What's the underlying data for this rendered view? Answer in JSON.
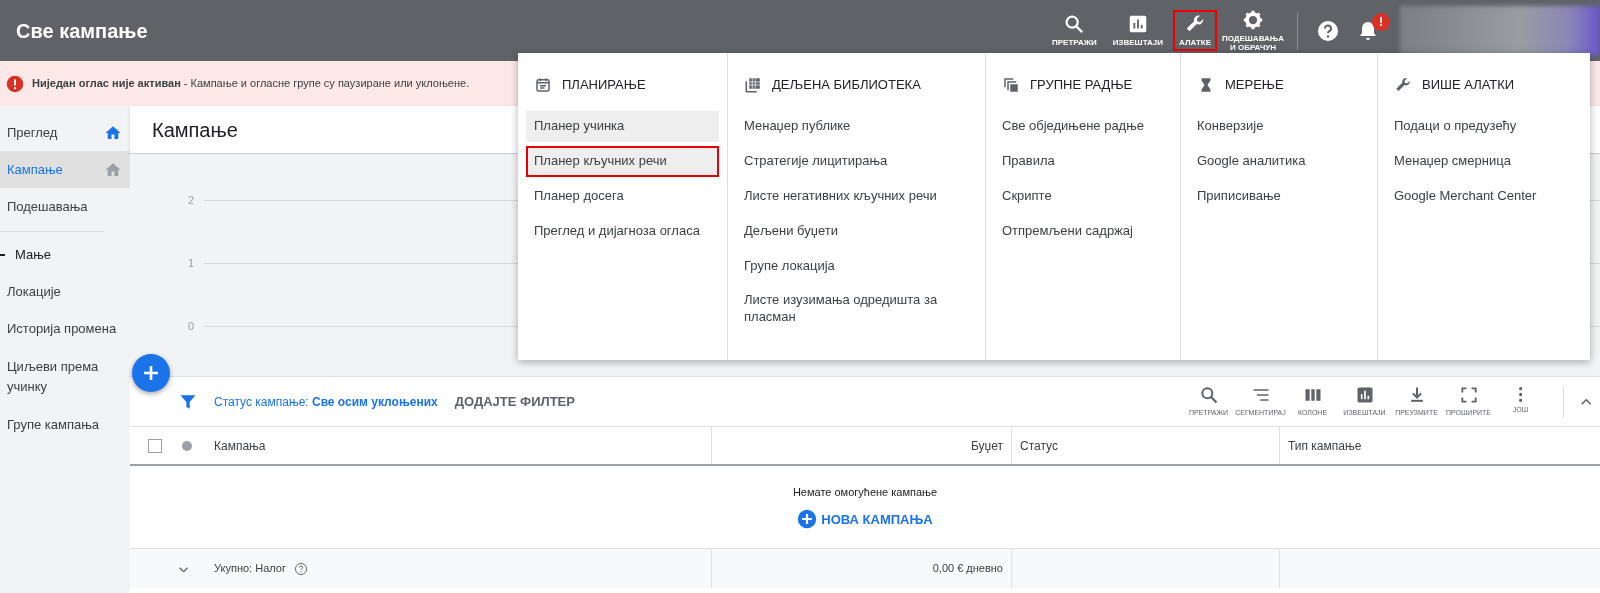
{
  "header": {
    "title": "Све кампање",
    "actions": [
      {
        "kind": "search",
        "label": "ПРЕТРАЖИ",
        "highlighted": false
      },
      {
        "kind": "reports",
        "label": "ИЗВЕШТАЈИ",
        "highlighted": false
      },
      {
        "kind": "tools",
        "label": "АЛАТКЕ",
        "highlighted": true
      },
      {
        "kind": "settings",
        "label": "ПОДЕШАВАЊА И ОБРАЧУН",
        "highlighted": false
      }
    ],
    "notification_badge": "!"
  },
  "alert": {
    "title": "Ниједан оглас није активан",
    "message": " - Кампање и огласне групе су паузиране или уклоњене."
  },
  "sidebar": {
    "items": [
      {
        "label": "Преглед",
        "kind": "home",
        "selected": false
      },
      {
        "label": "Кампање",
        "kind": "home",
        "selected": true
      },
      {
        "label": "Подешавања",
        "kind": "plain",
        "selected": false
      },
      {
        "label": "Мање",
        "kind": "toggle",
        "selected": false
      },
      {
        "label": "Локације",
        "kind": "plain",
        "selected": false
      },
      {
        "label": "Историја промена",
        "kind": "plain",
        "selected": false
      },
      {
        "label": "Циљеви према учинку",
        "kind": "plain",
        "selected": false
      },
      {
        "label": "Групе кампања",
        "kind": "plain",
        "selected": false
      }
    ]
  },
  "page_title": "Кампање",
  "chart": {
    "y_ticks": [
      "2",
      "1",
      "0"
    ]
  },
  "filter_bar": {
    "label": "Статус кампање:",
    "value": "Све осим уклоњених",
    "add_filter": "ДОДАЈТЕ ФИЛТЕР",
    "tools": [
      {
        "kind": "search",
        "label": "ПРЕТРАЖИ"
      },
      {
        "kind": "segment",
        "label": "СЕГМЕНТИРАЈ"
      },
      {
        "kind": "columns",
        "label": "КОЛОНЕ"
      },
      {
        "kind": "reports",
        "label": "ИЗВЕШТАЈИ"
      },
      {
        "kind": "download",
        "label": "ПРЕУЗМИТЕ"
      },
      {
        "kind": "expand",
        "label": "ПРОШИРИТЕ"
      },
      {
        "kind": "more",
        "label": "ЈОШ"
      }
    ]
  },
  "table": {
    "select_all_checked": false,
    "columns": [
      "Кампања",
      "Буџет",
      "Статус",
      "Тип кампање"
    ],
    "empty_message": "Немате омогућене кампање",
    "new_campaign": "НОВА КАМПАЊА",
    "total": {
      "label": "Укупно: Налог",
      "budget": "0,00 € дневно"
    }
  },
  "tools_menu": {
    "sections": [
      {
        "kind": "calendar",
        "title": "ПЛАНИРАЊЕ",
        "items": [
          {
            "label": "Планер учинка",
            "selected": true,
            "highlighted": false
          },
          {
            "label": "Планер кључних речи",
            "selected": true,
            "highlighted": true
          },
          {
            "label": "Планер досега",
            "selected": false,
            "highlighted": false
          },
          {
            "label": "Преглед и дијагноза огласа",
            "selected": false,
            "highlighted": false
          }
        ]
      },
      {
        "kind": "library",
        "title": "ДЕЉЕНА БИБЛИОТЕКА",
        "items": [
          {
            "label": "Менаџер публике",
            "selected": false,
            "highlighted": false
          },
          {
            "label": "Стратегије лицитирања",
            "selected": false,
            "highlighted": false
          },
          {
            "label": "Листе негативних кључних речи",
            "selected": false,
            "highlighted": false
          },
          {
            "label": "Дељени буџети",
            "selected": false,
            "highlighted": false
          },
          {
            "label": "Групе локација",
            "selected": false,
            "highlighted": false
          },
          {
            "label": "Листе изузимања одредишта за пласман",
            "selected": false,
            "highlighted": false
          }
        ]
      },
      {
        "kind": "bulk",
        "title": "ГРУПНЕ РАДЊЕ",
        "items": [
          {
            "label": "Све обједињене радње",
            "selected": false,
            "highlighted": false
          },
          {
            "label": "Правила",
            "selected": false,
            "highlighted": false
          },
          {
            "label": "Скрипте",
            "selected": false,
            "highlighted": false
          },
          {
            "label": "Отпремљени садржај",
            "selected": false,
            "highlighted": false
          }
        ]
      },
      {
        "kind": "measure",
        "title": "МЕРЕЊЕ",
        "items": [
          {
            "label": "Конверзије",
            "selected": false,
            "highlighted": false
          },
          {
            "label": "Google аналитика",
            "selected": false,
            "highlighted": false
          },
          {
            "label": "Приписивање",
            "selected": false,
            "highlighted": false
          }
        ]
      },
      {
        "kind": "tools",
        "title": "ВИШЕ АЛАТКИ",
        "items": [
          {
            "label": "Подаци о предузећу",
            "selected": false,
            "highlighted": false
          },
          {
            "label": "Менаџер смерница",
            "selected": false,
            "highlighted": false
          },
          {
            "label": "Google Merchant Center",
            "selected": false,
            "highlighted": false
          }
        ]
      }
    ]
  }
}
